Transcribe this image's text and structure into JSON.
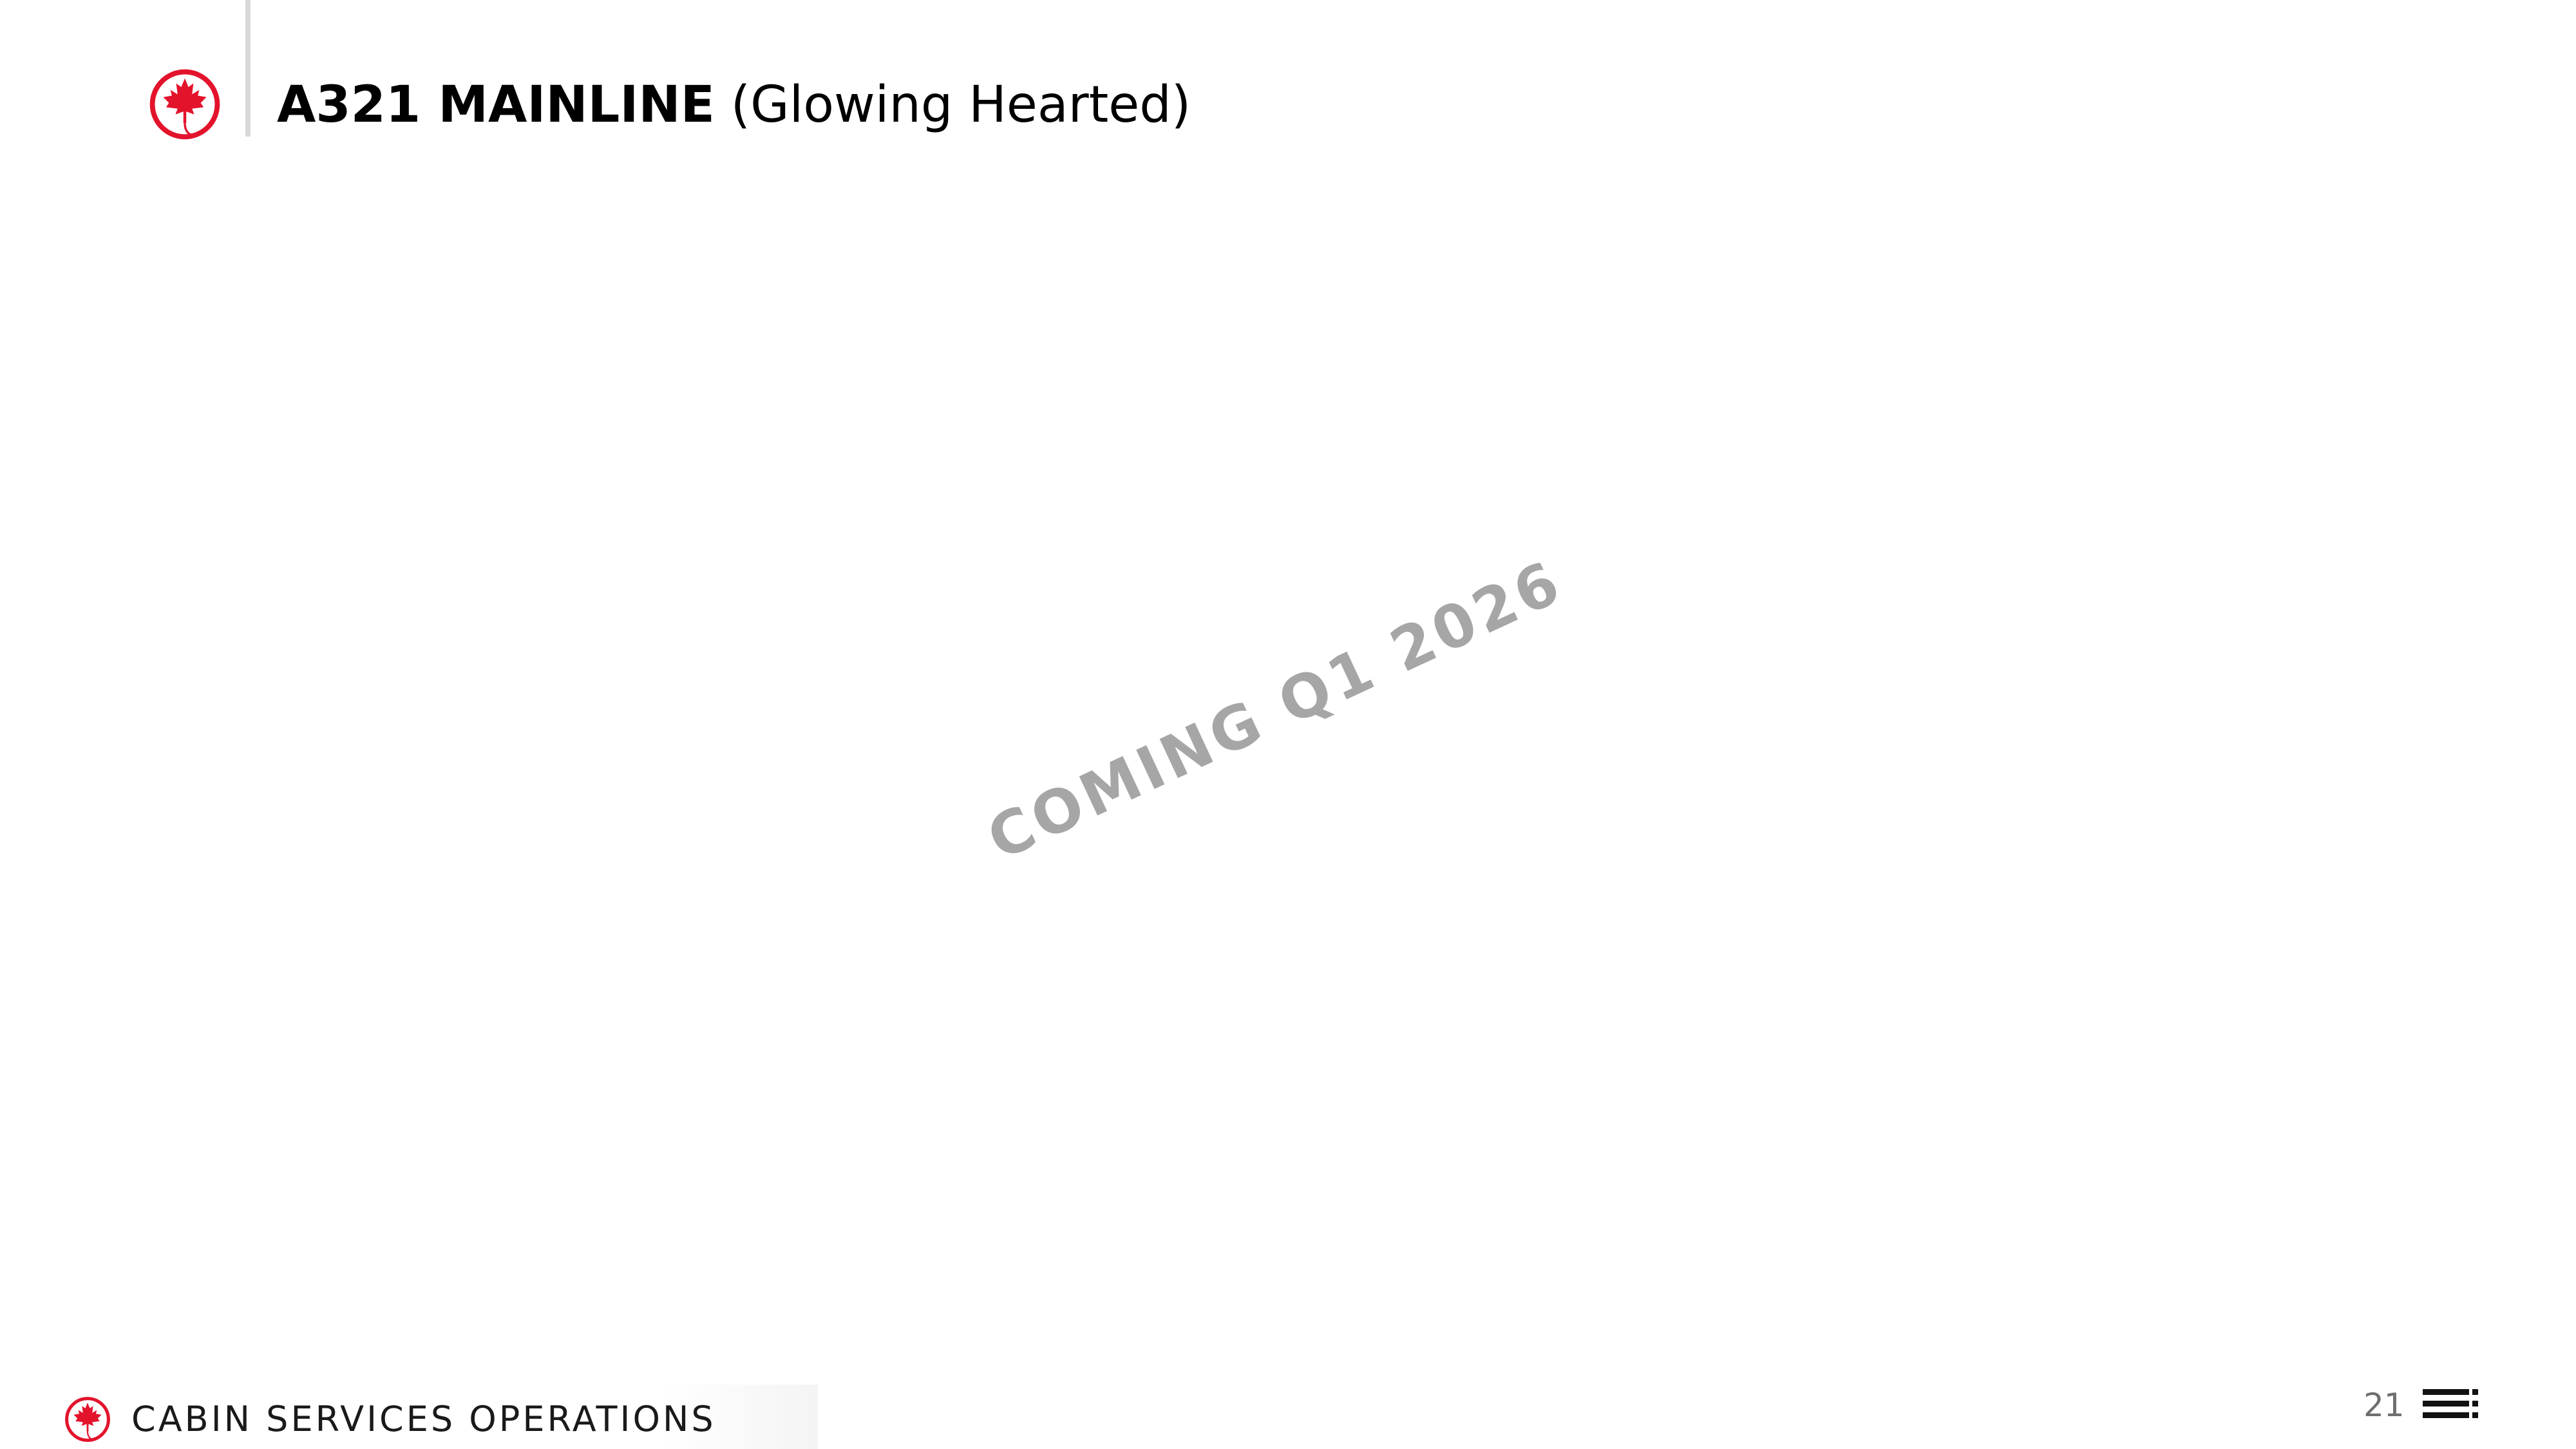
{
  "header": {
    "title_bold": "A321 MAINLINE",
    "title_rest": " (Glowing Hearted)",
    "logo_icon": "maple-leaf-roundel-icon"
  },
  "watermark": {
    "text": "COMING Q1 2026"
  },
  "footer": {
    "label": "CABIN SERVICES OPERATIONS",
    "logo_icon": "maple-leaf-roundel-icon",
    "page_number": "21",
    "nav_icon": "menu-lines-icon"
  },
  "colors": {
    "brand_red": "#e3132c",
    "text": "#000000",
    "watermark": "#a6a6a6",
    "divider": "#d9d9d9"
  }
}
